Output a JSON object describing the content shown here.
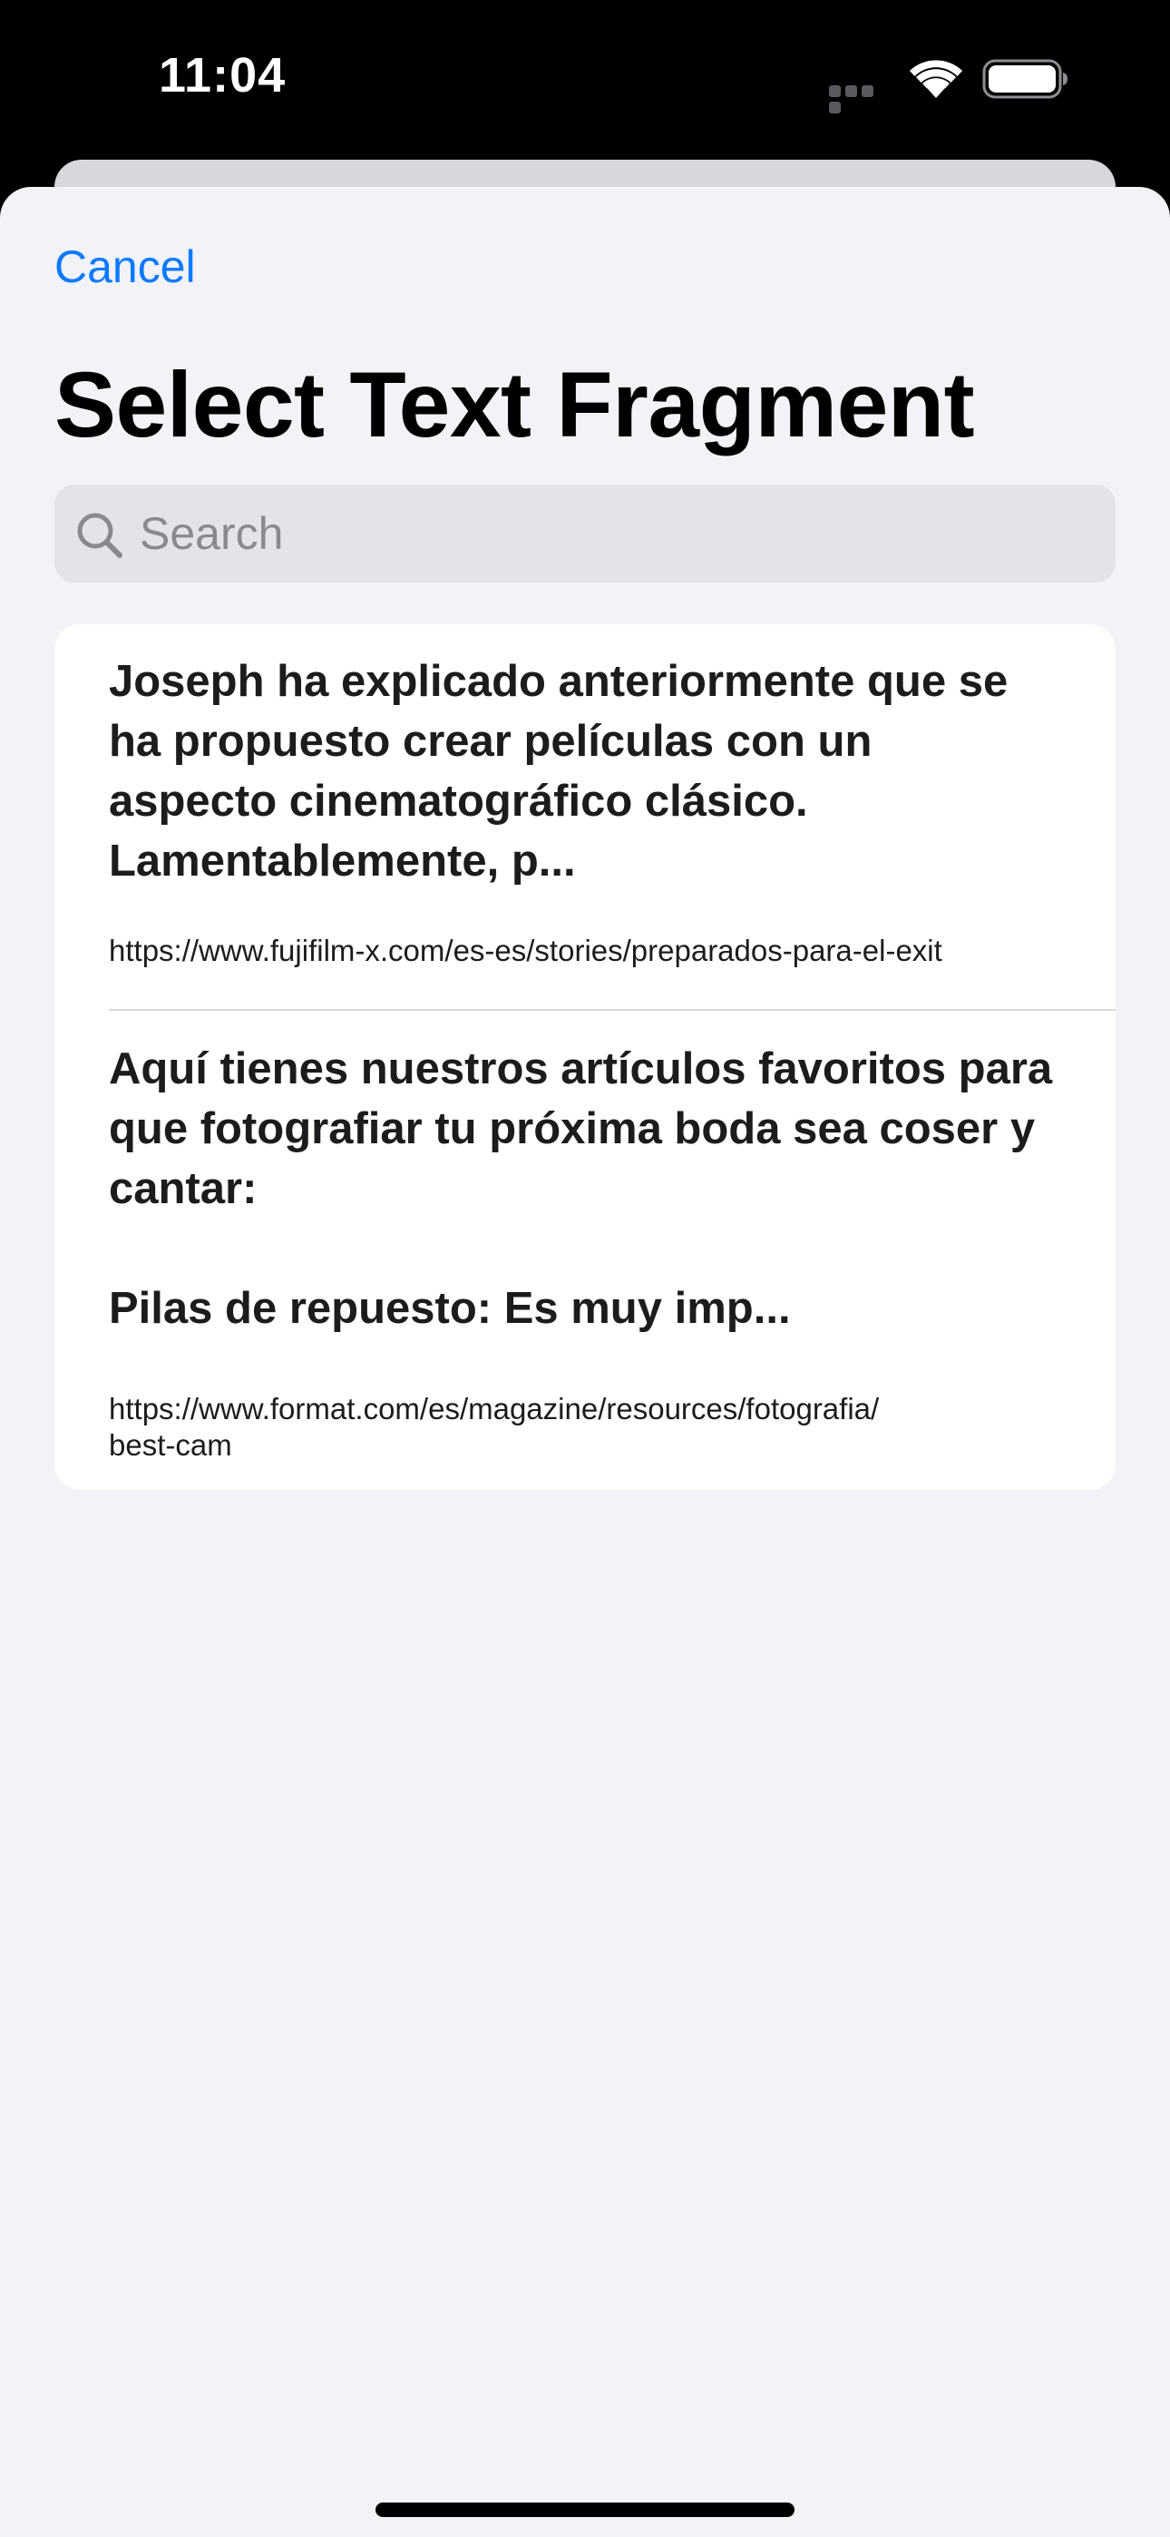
{
  "status_bar": {
    "time": "11:04",
    "icons": [
      "cellular-icon",
      "wifi-icon",
      "battery-icon"
    ]
  },
  "nav": {
    "cancel_label": "Cancel"
  },
  "header": {
    "title": "Select Text Fragment"
  },
  "search": {
    "placeholder": "Search",
    "value": ""
  },
  "fragments": [
    {
      "text": "Joseph ha explicado anteriormente que se\nha propuesto crear películas con un\naspecto cinematográfico clásico.\nLamentablemente, p...",
      "url": "https://www.fujifilm-x.com/es-es/stories/preparados-para-el-exit"
    },
    {
      "text": "Aquí tienes nuestros artículos favoritos para\nque fotografiar tu próxima boda sea coser y\ncantar:\n\nPilas de repuesto: Es muy imp...",
      "url": "https://www.format.com/es/magazine/resources/fotografia/\nbest-cam"
    }
  ],
  "colors": {
    "accent": "#0a7aff",
    "sheet_background": "#f2f2f7",
    "card_background": "#ffffff",
    "search_background": "#e3e3e9"
  }
}
